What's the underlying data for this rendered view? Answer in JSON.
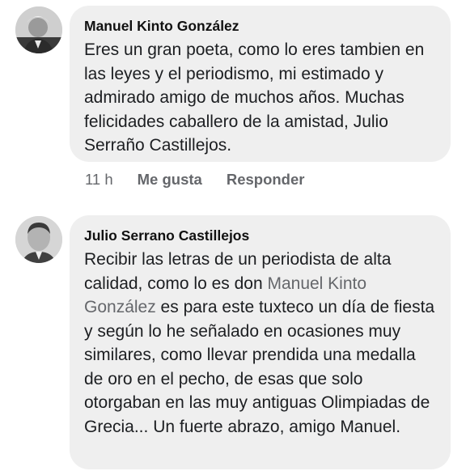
{
  "comments": [
    {
      "author": "Manuel Kinto González",
      "text": "Eres un gran poeta, como lo eres tambien en las leyes y el periodismo, mi estimado y admirado amigo de muchos años. Muchas felicidades caballero de la amistad, Julio Serraño Castillejos.",
      "time": "11 h",
      "like_label": "Me gusta",
      "reply_label": "Responder"
    },
    {
      "author": "Julio Serrano Castillejos",
      "text_before": "Recibir las letras de un periodista de alta calidad, como lo es don ",
      "mention": "Manuel Kinto González",
      "text_after": " es para este tuxteco un día de fiesta y según lo he señalado en ocasiones muy similares, como llevar prendida una medalla de oro en el pecho, de esas que solo otorgaban en las muy antiguas Olimpiadas de Grecia... Un fuerte abrazo, amigo Manuel."
    }
  ],
  "colors": {
    "bubble": "#efefef",
    "secondary_text": "#65676b",
    "mention": "#65676b"
  },
  "icons": [
    "avatar-manuel",
    "avatar-julio"
  ]
}
